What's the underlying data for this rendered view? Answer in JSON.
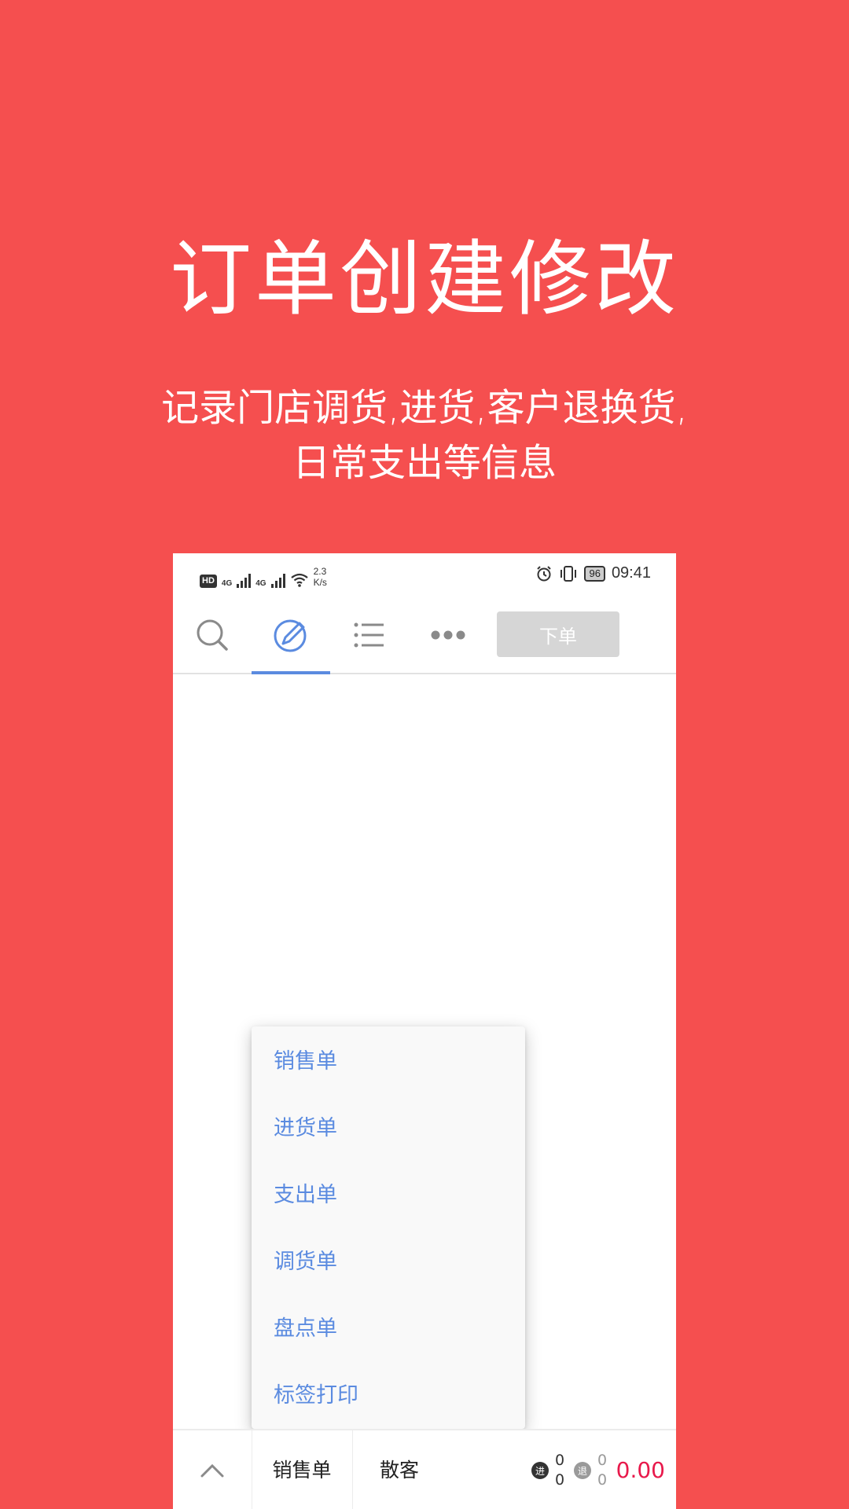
{
  "promo": {
    "title": "订单创建修改",
    "subtitle_line1": "记录门店调货,进货,客户退换货,",
    "subtitle_line2": "日常支出等信息"
  },
  "statusbar": {
    "hd_badge": "HD",
    "network1": "4G",
    "network2": "4G",
    "speed_value": "2.3",
    "speed_unit": "K/s",
    "battery": "96",
    "time": "09:41"
  },
  "toolbar": {
    "order_button_label": "下单",
    "active_tab": "edit"
  },
  "menu": {
    "items": [
      {
        "label": "销售单"
      },
      {
        "label": "进货单"
      },
      {
        "label": "支出单"
      },
      {
        "label": "调货单"
      },
      {
        "label": "盘点单"
      },
      {
        "label": "标签打印"
      }
    ]
  },
  "bottom": {
    "order_type": "销售单",
    "customer": "散客",
    "in_badge": "进",
    "in_count_top": "0",
    "in_count_bottom": "0",
    "return_badge": "退",
    "return_count_top": "0",
    "return_count_bottom": "0",
    "total": "0.00"
  },
  "colors": {
    "background": "#f54f4f",
    "accent": "#5b8be0",
    "total": "#e8194b",
    "order_button": "#d6d6d6"
  }
}
